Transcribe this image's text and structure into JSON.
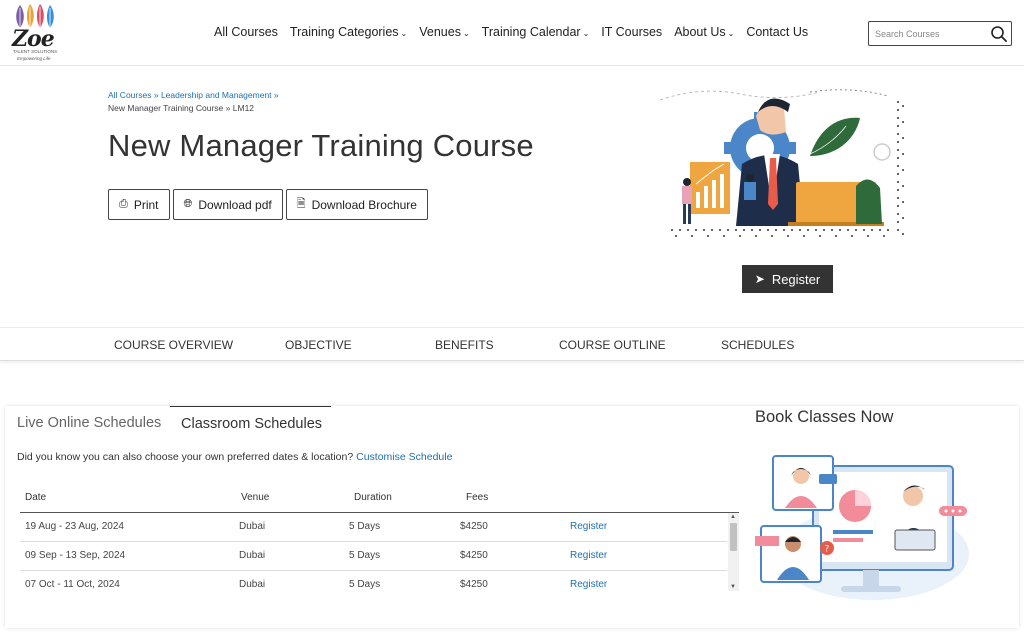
{
  "header": {
    "logo": {
      "name": "Zoe",
      "subtitle": "TALENT SOLUTIONS",
      "tagline": "Empowering Life"
    },
    "nav": [
      {
        "label": "All Courses",
        "dropdown": false
      },
      {
        "label": "Training Categories",
        "dropdown": true
      },
      {
        "label": "Venues",
        "dropdown": true
      },
      {
        "label": "Training Calendar",
        "dropdown": true
      },
      {
        "label": "IT Courses",
        "dropdown": false
      },
      {
        "label": "About Us",
        "dropdown": true
      },
      {
        "label": "Contact Us",
        "dropdown": false
      }
    ],
    "search": {
      "placeholder": "Search Courses",
      "icon": "search-icon"
    }
  },
  "breadcrumb": {
    "items": [
      "All Courses",
      "Leadership and Management"
    ],
    "current": "New Manager Training Course",
    "code": "LM12",
    "separator": "»"
  },
  "page": {
    "title": "New Manager Training Course",
    "actions": [
      {
        "label": "Print",
        "icon": "printer-icon"
      },
      {
        "label": "Download pdf",
        "icon": "globe-icon"
      },
      {
        "label": "Download Brochure",
        "icon": "document-icon"
      }
    ],
    "register_label": "Register"
  },
  "course_tabs": [
    "COURSE OVERVIEW",
    "OBJECTIVE",
    "BENEFITS",
    "COURSE OUTLINE",
    "SCHEDULES"
  ],
  "schedules": {
    "tabs": [
      {
        "label": "Live Online Schedules",
        "active": false
      },
      {
        "label": "Classroom Schedules",
        "active": true
      }
    ],
    "note": "Did you know you can also choose your own preferred dates & location?",
    "note_link": "Customise Schedule",
    "columns": [
      "Date",
      "Venue",
      "Duration",
      "Fees"
    ],
    "rows": [
      {
        "date": "19 Aug - 23 Aug, 2024",
        "venue": "Dubai",
        "duration": "5 Days",
        "fees": "$4250",
        "action": "Register"
      },
      {
        "date": "09 Sep - 13 Sep, 2024",
        "venue": "Dubai",
        "duration": "5 Days",
        "fees": "$4250",
        "action": "Register"
      },
      {
        "date": "07 Oct - 11 Oct, 2024",
        "venue": "Dubai",
        "duration": "5 Days",
        "fees": "$4250",
        "action": "Register"
      }
    ],
    "book_title": "Book Classes Now"
  },
  "colors": {
    "link": "#1f6fb2",
    "dark_button": "#333333",
    "accent_orange": "#f0a640"
  }
}
